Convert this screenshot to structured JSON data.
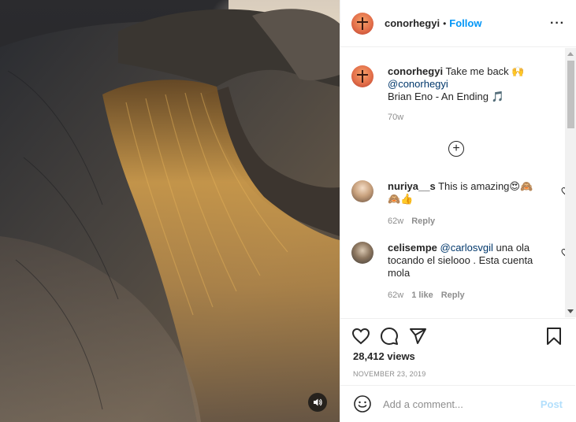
{
  "post": {
    "author": "conorhegyi",
    "separator": "•",
    "follow_label": "Follow",
    "more_icon": "ellipsis-icon"
  },
  "caption": {
    "user": "conorhegyi",
    "text": "Take me back",
    "emoji": "🙌",
    "mention": "@conorhegyi",
    "music_line": "Brian Eno - An Ending",
    "music_emoji": "🎵",
    "age": "70w"
  },
  "load_more_icon": "plus-circle-icon",
  "comments": [
    {
      "user": "nuriya__s",
      "text": "This is amazing",
      "emoji_line1": "😍🙈",
      "emoji_line2": "🙈👍",
      "age": "62w",
      "reply": "Reply"
    },
    {
      "user": "celisempe",
      "mention": "@carlosvgil",
      "text": "una ola tocando el sielooo . Esta cuenta mola",
      "age": "62w",
      "likes": "1 like",
      "reply": "Reply"
    }
  ],
  "actions": {
    "like_icon": "heart-icon",
    "comment_icon": "comment-icon",
    "share_icon": "send-icon",
    "save_icon": "bookmark-icon"
  },
  "views": "28,412 views",
  "date": "NOVEMBER 23, 2019",
  "composer": {
    "emoji_icon": "smiley-icon",
    "placeholder": "Add a comment...",
    "post_label": "Post"
  },
  "media": {
    "mute_icon": "speaker-icon"
  }
}
